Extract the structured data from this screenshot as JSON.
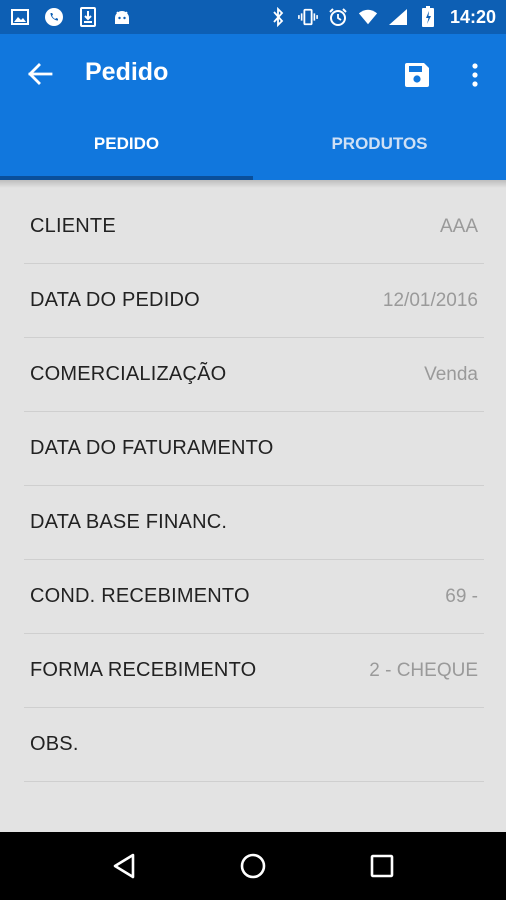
{
  "status_bar": {
    "time": "14:20",
    "left_icons": [
      "image-icon",
      "whatsapp-icon",
      "download-icon",
      "android-icon"
    ],
    "right_icons": [
      "bluetooth-icon",
      "vibrate-icon",
      "alarm-icon",
      "wifi-icon",
      "signal-icon",
      "battery-icon"
    ]
  },
  "toolbar": {
    "title": "Pedido",
    "back_icon": "arrow-back-icon",
    "save_icon": "save-icon",
    "more_icon": "more-vert-icon"
  },
  "tabs": [
    {
      "label": "PEDIDO",
      "active": true
    },
    {
      "label": "PRODUTOS",
      "active": false
    }
  ],
  "fields": [
    {
      "label": "CLIENTE",
      "value": "AAA"
    },
    {
      "label": "DATA DO PEDIDO",
      "value": "12/01/2016"
    },
    {
      "label": "COMERCIALIZAÇÃO",
      "value": "Venda"
    },
    {
      "label": "DATA DO FATURAMENTO",
      "value": ""
    },
    {
      "label": "DATA BASE FINANC.",
      "value": ""
    },
    {
      "label": "COND. RECEBIMENTO",
      "value": "69 -"
    },
    {
      "label": "FORMA RECEBIMENTO",
      "value": "2 - CHEQUE"
    },
    {
      "label": "OBS.",
      "value": ""
    }
  ],
  "colors": {
    "status_bar": "#0d5fb4",
    "app_bar": "#1177dd",
    "background": "#e3e3e3"
  }
}
